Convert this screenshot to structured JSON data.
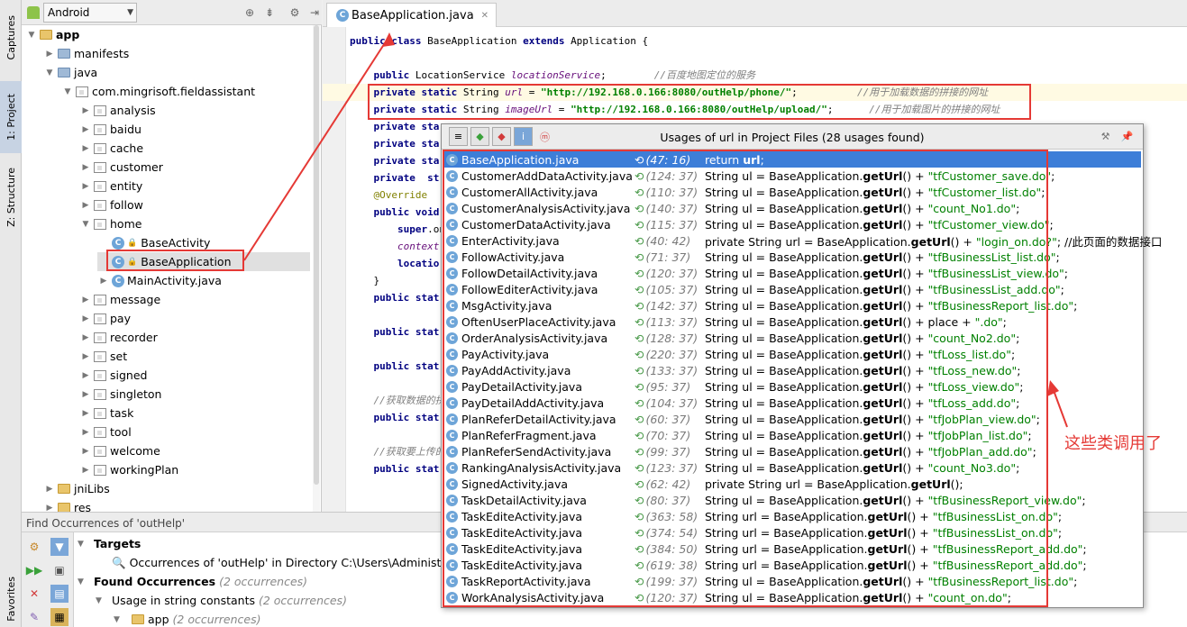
{
  "left_strip": {
    "captures": "Captures",
    "project": "1: Project",
    "structure": "Z: Structure",
    "favorites": "Favorites"
  },
  "project": {
    "view_mode": "Android",
    "tree": [
      {
        "label": "app",
        "depth": 0,
        "arrow": "▼",
        "icon": "folder",
        "bold": true
      },
      {
        "label": "manifests",
        "depth": 1,
        "arrow": "▶",
        "icon": "folder-blue"
      },
      {
        "label": "java",
        "depth": 1,
        "arrow": "▼",
        "icon": "folder-blue"
      },
      {
        "label": "com.mingrisoft.fieldassistant",
        "depth": 2,
        "arrow": "▼",
        "icon": "package"
      },
      {
        "label": "analysis",
        "depth": 3,
        "arrow": "▶",
        "icon": "package"
      },
      {
        "label": "baidu",
        "depth": 3,
        "arrow": "▶",
        "icon": "package"
      },
      {
        "label": "cache",
        "depth": 3,
        "arrow": "▶",
        "icon": "package"
      },
      {
        "label": "customer",
        "depth": 3,
        "arrow": "▶",
        "icon": "package"
      },
      {
        "label": "entity",
        "depth": 3,
        "arrow": "▶",
        "icon": "package"
      },
      {
        "label": "follow",
        "depth": 3,
        "arrow": "▶",
        "icon": "package"
      },
      {
        "label": "home",
        "depth": 3,
        "arrow": "▼",
        "icon": "package"
      },
      {
        "label": "BaseActivity",
        "depth": 4,
        "arrow": "",
        "icon": "class"
      },
      {
        "label": "BaseApplication",
        "depth": 4,
        "arrow": "",
        "icon": "class",
        "selected": true
      },
      {
        "label": "MainActivity.java",
        "depth": 4,
        "arrow": "▶",
        "icon": "class"
      },
      {
        "label": "message",
        "depth": 3,
        "arrow": "▶",
        "icon": "package"
      },
      {
        "label": "pay",
        "depth": 3,
        "arrow": "▶",
        "icon": "package"
      },
      {
        "label": "recorder",
        "depth": 3,
        "arrow": "▶",
        "icon": "package"
      },
      {
        "label": "set",
        "depth": 3,
        "arrow": "▶",
        "icon": "package"
      },
      {
        "label": "signed",
        "depth": 3,
        "arrow": "▶",
        "icon": "package"
      },
      {
        "label": "singleton",
        "depth": 3,
        "arrow": "▶",
        "icon": "package"
      },
      {
        "label": "task",
        "depth": 3,
        "arrow": "▶",
        "icon": "package"
      },
      {
        "label": "tool",
        "depth": 3,
        "arrow": "▶",
        "icon": "package"
      },
      {
        "label": "welcome",
        "depth": 3,
        "arrow": "▶",
        "icon": "package"
      },
      {
        "label": "workingPlan",
        "depth": 3,
        "arrow": "▶",
        "icon": "package"
      },
      {
        "label": "jniLibs",
        "depth": 1,
        "arrow": "▶",
        "icon": "folder"
      },
      {
        "label": "res",
        "depth": 1,
        "arrow": "▶",
        "icon": "folder"
      }
    ]
  },
  "editor": {
    "tab": "BaseApplication.java",
    "lines": [
      {
        "segs": [
          [
            "kw",
            "public "
          ],
          [
            "kw",
            "class "
          ],
          [
            "",
            "BaseApplication "
          ],
          [
            "kw",
            "extends "
          ],
          [
            "",
            "Application {"
          ]
        ]
      },
      {
        "segs": []
      },
      {
        "segs": [
          [
            "kw",
            "    public "
          ],
          [
            "",
            "LocationService "
          ],
          [
            "fld",
            "locationService"
          ],
          [
            "",
            ";        "
          ],
          [
            "cm",
            "//百度地图定位的服务"
          ]
        ]
      },
      {
        "segs": [
          [
            "kw",
            "    private static "
          ],
          [
            "",
            "String "
          ],
          [
            "fld",
            "url"
          ],
          [
            "",
            " = "
          ],
          [
            "str",
            "\"http://192.168.0.166:8080/outHelp/phone/\""
          ],
          [
            "",
            ";          "
          ],
          [
            "cm",
            "//用于加载数据的拼接的网址"
          ]
        ],
        "hl": true
      },
      {
        "segs": [
          [
            "kw",
            "    private static "
          ],
          [
            "",
            "String "
          ],
          [
            "fld",
            "imageUrl"
          ],
          [
            "",
            " = "
          ],
          [
            "str",
            "\"http://192.168.0.166:8080/outHelp/upload/\""
          ],
          [
            "",
            ";      "
          ],
          [
            "cm",
            "//用于加载图片的拼接的网址"
          ]
        ]
      },
      {
        "segs": [
          [
            "kw",
            "    private sta"
          ]
        ]
      },
      {
        "segs": [
          [
            "kw",
            "    private sta"
          ]
        ]
      },
      {
        "segs": [
          [
            "kw",
            "    private sta"
          ]
        ]
      },
      {
        "segs": [
          [
            "kw",
            "    private  st"
          ]
        ]
      },
      {
        "segs": [
          [
            "ann",
            "    @Override"
          ]
        ]
      },
      {
        "segs": [
          [
            "kw",
            "    public void"
          ]
        ]
      },
      {
        "segs": [
          [
            "kw",
            "        super"
          ],
          [
            "",
            ".on"
          ]
        ]
      },
      {
        "segs": [
          [
            "fld",
            "        context"
          ],
          [
            "",
            " ="
          ]
        ]
      },
      {
        "segs": [
          [
            "kw",
            "        locatio"
          ]
        ]
      },
      {
        "segs": [
          [
            "",
            "    }"
          ]
        ]
      },
      {
        "segs": [
          [
            "kw",
            "    public stat"
          ]
        ]
      },
      {
        "segs": []
      },
      {
        "segs": [
          [
            "kw",
            "    public stat"
          ]
        ]
      },
      {
        "segs": []
      },
      {
        "segs": [
          [
            "kw",
            "    public stat"
          ]
        ]
      },
      {
        "segs": []
      },
      {
        "segs": [
          [
            "cm",
            "    //获取数据的拼"
          ]
        ]
      },
      {
        "segs": [
          [
            "kw",
            "    public stat"
          ]
        ]
      },
      {
        "segs": []
      },
      {
        "segs": [
          [
            "cm",
            "    //获取要上传的"
          ]
        ]
      },
      {
        "segs": [
          [
            "kw",
            "    public stat"
          ]
        ]
      }
    ]
  },
  "popup": {
    "title": "Usages of url in Project Files (28 usages found)",
    "usages": [
      {
        "file": "BaseApplication.java",
        "pos": "(47: 16)",
        "pre": "return ",
        "method": "url",
        "post": ";",
        "str": "",
        "tail": "",
        "selected": true
      },
      {
        "file": "CustomerAddDataActivity.java",
        "pos": "(124: 37)",
        "pre": "String ul = BaseApplication.",
        "method": "getUrl",
        "post": "() + ",
        "str": "\"tfCustomer_save.do\"",
        "tail": ";"
      },
      {
        "file": "CustomerAllActivity.java",
        "pos": "(110: 37)",
        "pre": "String ul = BaseApplication.",
        "method": "getUrl",
        "post": "() + ",
        "str": "\"tfCustomer_list.do\"",
        "tail": ";"
      },
      {
        "file": "CustomerAnalysisActivity.java",
        "pos": "(140: 37)",
        "pre": "String ul = BaseApplication.",
        "method": "getUrl",
        "post": "() + ",
        "str": "\"count_No1.do\"",
        "tail": ";"
      },
      {
        "file": "CustomerDataActivity.java",
        "pos": "(115: 37)",
        "pre": "String ul = BaseApplication.",
        "method": "getUrl",
        "post": "() + ",
        "str": "\"tfCustomer_view.do\"",
        "tail": ";"
      },
      {
        "file": "EnterActivity.java",
        "pos": "(40: 42)",
        "pre": "private String url = BaseApplication.",
        "method": "getUrl",
        "post": "() + ",
        "str": "\"login_on.do?\"",
        "tail": ";              //此页面的数据接口"
      },
      {
        "file": "FollowActivity.java",
        "pos": "(71: 37)",
        "pre": "String ul = BaseApplication.",
        "method": "getUrl",
        "post": "() + ",
        "str": "\"tfBusinessList_list.do\"",
        "tail": ";"
      },
      {
        "file": "FollowDetailActivity.java",
        "pos": "(120: 37)",
        "pre": "String ul = BaseApplication.",
        "method": "getUrl",
        "post": "() + ",
        "str": "\"tfBusinessList_view.do\"",
        "tail": ";"
      },
      {
        "file": "FollowEditerActivity.java",
        "pos": "(105: 37)",
        "pre": "String ul = BaseApplication.",
        "method": "getUrl",
        "post": "() + ",
        "str": "\"tfBusinessList_add.do\"",
        "tail": ";"
      },
      {
        "file": "MsgActivity.java",
        "pos": "(142: 37)",
        "pre": "String ul = BaseApplication.",
        "method": "getUrl",
        "post": "() + ",
        "str": "\"tfBusinessReport_list.do\"",
        "tail": ";"
      },
      {
        "file": "OftenUserPlaceActivity.java",
        "pos": "(113: 37)",
        "pre": "String ul = BaseApplication.",
        "method": "getUrl",
        "post": "() + place + ",
        "str": "\".do\"",
        "tail": ";"
      },
      {
        "file": "OrderAnalysisActivity.java",
        "pos": "(128: 37)",
        "pre": "String ul = BaseApplication.",
        "method": "getUrl",
        "post": "() + ",
        "str": "\"count_No2.do\"",
        "tail": ";"
      },
      {
        "file": "PayActivity.java",
        "pos": "(220: 37)",
        "pre": "String ul = BaseApplication.",
        "method": "getUrl",
        "post": "() + ",
        "str": "\"tfLoss_list.do\"",
        "tail": ";"
      },
      {
        "file": "PayAddActivity.java",
        "pos": "(133: 37)",
        "pre": "String ul = BaseApplication.",
        "method": "getUrl",
        "post": "() + ",
        "str": "\"tfLoss_new.do\"",
        "tail": ";"
      },
      {
        "file": "PayDetailActivity.java",
        "pos": "(95: 37)",
        "pre": "String ul = BaseApplication.",
        "method": "getUrl",
        "post": "() + ",
        "str": "\"tfLoss_view.do\"",
        "tail": ";"
      },
      {
        "file": "PayDetailAddActivity.java",
        "pos": "(104: 37)",
        "pre": "String ul = BaseApplication.",
        "method": "getUrl",
        "post": "() + ",
        "str": "\"tfLoss_add.do\"",
        "tail": ";"
      },
      {
        "file": "PlanReferDetailActivity.java",
        "pos": "(60: 37)",
        "pre": "String ul = BaseApplication.",
        "method": "getUrl",
        "post": "() + ",
        "str": "\"tfJobPlan_view.do\"",
        "tail": ";"
      },
      {
        "file": "PlanReferFragment.java",
        "pos": "(70: 37)",
        "pre": "String ul = BaseApplication.",
        "method": "getUrl",
        "post": "() + ",
        "str": "\"tfJobPlan_list.do\"",
        "tail": ";"
      },
      {
        "file": "PlanReferSendActivity.java",
        "pos": "(99: 37)",
        "pre": "String ul = BaseApplication.",
        "method": "getUrl",
        "post": "() + ",
        "str": "\"tfJobPlan_add.do\"",
        "tail": ";"
      },
      {
        "file": "RankingAnalysisActivity.java",
        "pos": "(123: 37)",
        "pre": "String ul = BaseApplication.",
        "method": "getUrl",
        "post": "() + ",
        "str": "\"count_No3.do\"",
        "tail": ";"
      },
      {
        "file": "SignedActivity.java",
        "pos": "(62: 42)",
        "pre": "private String url = BaseApplication.",
        "method": "getUrl",
        "post": "();",
        "str": "",
        "tail": ""
      },
      {
        "file": "TaskDetailActivity.java",
        "pos": "(80: 37)",
        "pre": "String ul = BaseApplication.",
        "method": "getUrl",
        "post": "() + ",
        "str": "\"tfBusinessReport_view.do\"",
        "tail": ";"
      },
      {
        "file": "TaskEditeActivity.java",
        "pos": "(363: 58)",
        "pre": "String url = BaseApplication.",
        "method": "getUrl",
        "post": "() + ",
        "str": "\"tfBusinessList_on.do\"",
        "tail": ";"
      },
      {
        "file": "TaskEditeActivity.java",
        "pos": "(374: 54)",
        "pre": "String url = BaseApplication.",
        "method": "getUrl",
        "post": "() + ",
        "str": "\"tfBusinessList_on.do\"",
        "tail": ";"
      },
      {
        "file": "TaskEditeActivity.java",
        "pos": "(384: 50)",
        "pre": "String url = BaseApplication.",
        "method": "getUrl",
        "post": "() + ",
        "str": "\"tfBusinessReport_add.do\"",
        "tail": ";"
      },
      {
        "file": "TaskEditeActivity.java",
        "pos": "(619: 38)",
        "pre": "String url = BaseApplication.",
        "method": "getUrl",
        "post": "() + ",
        "str": "\"tfBusinessReport_add.do\"",
        "tail": ";"
      },
      {
        "file": "TaskReportActivity.java",
        "pos": "(199: 37)",
        "pre": "String ul = BaseApplication.",
        "method": "getUrl",
        "post": "() + ",
        "str": "\"tfBusinessReport_list.do\"",
        "tail": ";"
      },
      {
        "file": "WorkAnalysisActivity.java",
        "pos": "(120: 37)",
        "pre": "String ul = BaseApplication.",
        "method": "getUrl",
        "post": "() + ",
        "str": "\"count_on.do\"",
        "tail": ";"
      }
    ]
  },
  "find": {
    "header": "Find Occurrences of 'outHelp'",
    "targets": "Targets",
    "occurrences_of": "Occurrences of 'outHelp' in Directory C:\\Users\\Administrato",
    "found": "Found Occurrences",
    "found_count": "(2 occurrences)",
    "usage": "Usage in string constants",
    "usage_count": "(2 occurrences)",
    "app": "app",
    "app_count": "(2 occurrences)"
  },
  "annotation": {
    "note": "这些类调用了",
    "color": "#e53935"
  }
}
